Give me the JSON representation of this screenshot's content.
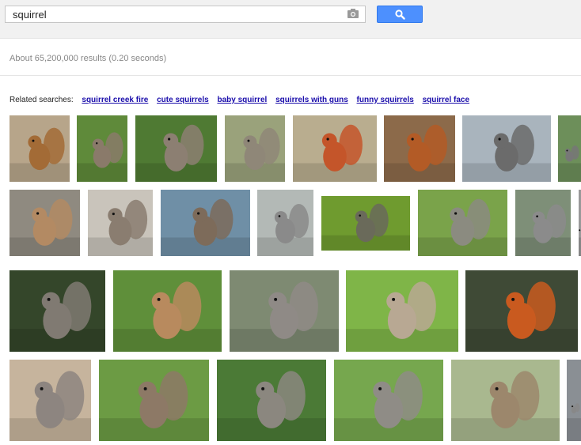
{
  "search": {
    "query": "squirrel",
    "camera_icon": "camera-icon",
    "button_icon": "search-icon"
  },
  "stats": "About 65,200,000 results (0.20 seconds)",
  "related": {
    "label": "Related searches:",
    "items": [
      "squirrel creek fire",
      "cute squirrels",
      "baby squirrel",
      "squirrels with guns",
      "funny squirrels",
      "squirrel face"
    ]
  },
  "colors": {
    "accent": "#4d90fe",
    "link": "#1a0dab"
  }
}
